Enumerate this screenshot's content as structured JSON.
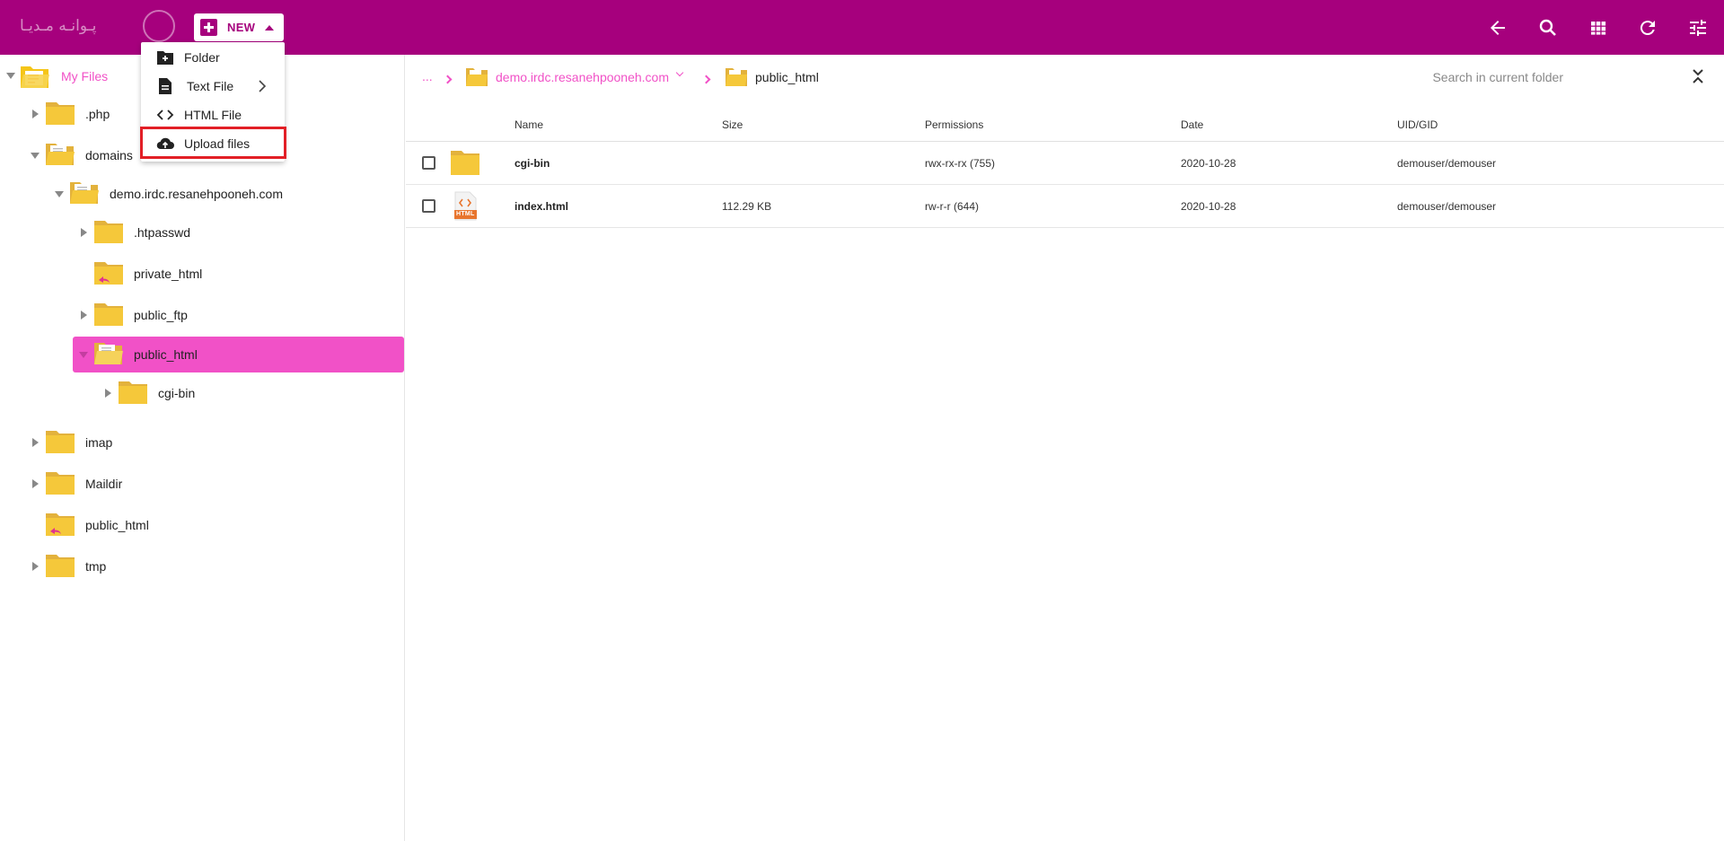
{
  "colors": {
    "brand": "#a6007d",
    "accent": "#f151c7",
    "folder": "#f5c518",
    "highlight": "#e21f26"
  },
  "header": {
    "logo_text": "پـوانـه مـدیـا",
    "new_button_label": "NEW",
    "icons": [
      "back-arrow-icon",
      "search-icon",
      "grid-view-icon",
      "refresh-icon",
      "settings-sliders-icon"
    ]
  },
  "new_menu": {
    "items": [
      {
        "label": "Folder",
        "icon": "new-folder-icon"
      },
      {
        "label": "Text File",
        "icon": "text-file-icon",
        "has_submenu": true
      },
      {
        "label": "HTML File",
        "icon": "code-icon"
      },
      {
        "label": "Upload files",
        "icon": "cloud-upload-icon",
        "highlighted": true
      }
    ]
  },
  "tree": {
    "root_label": "My Files",
    "nodes": [
      {
        "label": ".php"
      },
      {
        "label": "domains"
      },
      {
        "label": "demo.irdc.resanehpooneh.com"
      },
      {
        "label": ".htpasswd"
      },
      {
        "label": "private_html"
      },
      {
        "label": "public_ftp"
      },
      {
        "label": "public_html",
        "selected": true
      },
      {
        "label": "cgi-bin"
      },
      {
        "label": "imap"
      },
      {
        "label": "Maildir"
      },
      {
        "label": "public_html"
      },
      {
        "label": "tmp"
      }
    ]
  },
  "breadcrumb": {
    "ellipsis": "...",
    "domain": "demo.irdc.resanehpooneh.com",
    "current": "public_html"
  },
  "search": {
    "placeholder": "Search in current folder"
  },
  "table": {
    "headers": {
      "name": "Name",
      "size": "Size",
      "permissions": "Permissions",
      "date": "Date",
      "uid": "UID/GID"
    },
    "rows": [
      {
        "icon": "folder-icon",
        "name": "cgi-bin",
        "size": "",
        "permissions": "rwx-rx-rx (755)",
        "date": "2020-10-28",
        "uid": "demouser/demouser"
      },
      {
        "icon": "html-file-icon",
        "icon_text": "HTML",
        "name": "index.html",
        "size": "112.29 KB",
        "permissions": "rw-r-r (644)",
        "date": "2020-10-28",
        "uid": "demouser/demouser"
      }
    ]
  }
}
